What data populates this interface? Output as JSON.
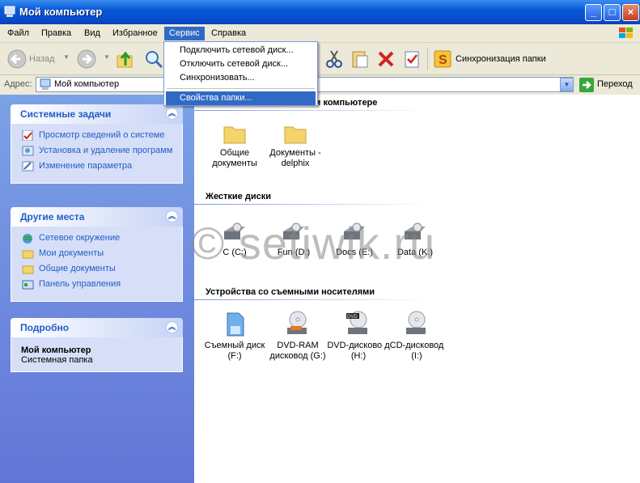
{
  "window": {
    "title": "Мой компьютер"
  },
  "menu": {
    "items": [
      "Файл",
      "Правка",
      "Вид",
      "Избранное",
      "Сервис",
      "Справка"
    ],
    "active_index": 4
  },
  "service_menu": {
    "items": [
      "Подключить сетевой диск...",
      "Отключить сетевой диск...",
      "Синхронизовать...",
      "Свойства папки..."
    ],
    "highlighted_index": 3
  },
  "toolbar": {
    "back_label": "Назад",
    "sync_label": "Синхронизация папки"
  },
  "address": {
    "label": "Адрес:",
    "value": "Мой компьютер",
    "go_label": "Переход"
  },
  "left_panes": {
    "system_tasks": {
      "title": "Системные задачи",
      "links": [
        "Просмотр сведений о системе",
        "Установка и удаление программ",
        "Изменение параметра"
      ]
    },
    "other_places": {
      "title": "Другие места",
      "links": [
        "Сетевое окружение",
        "Мои документы",
        "Общие документы",
        "Панель управления"
      ]
    },
    "details": {
      "title": "Подробно",
      "name": "Мой компьютер",
      "type": "Системная папка"
    }
  },
  "sections": {
    "stored_files": {
      "title": "отом компьютере",
      "items": [
        "Общие документы",
        "Документы - delphix"
      ]
    },
    "hard_disks": {
      "title": "Жесткие диски",
      "items": [
        "C (C:)",
        "Fun (D:)",
        "Docs (E:)",
        "Data (K:)"
      ]
    },
    "removable": {
      "title": "Устройства со съемными носителями",
      "items": [
        "Съемный диск (F:)",
        "DVD-RAM дисковод (G:)",
        "DVD-дисково д (H:)",
        "CD-дисковод (I:)"
      ]
    }
  },
  "watermark": "© setiwik.ru",
  "colors": {
    "titlebar": "#0a5ad8",
    "accent": "#316ac5",
    "leftpane": "#6f8ddf",
    "link": "#215dc6"
  }
}
